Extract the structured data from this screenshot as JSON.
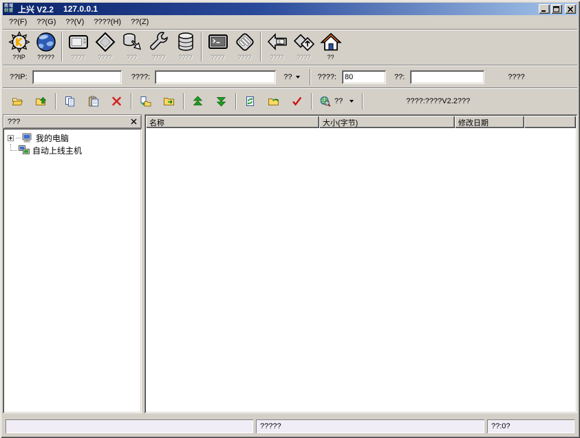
{
  "colors": {
    "window_bg": "#D4D0C8",
    "titlebar_gradient_start": "#0B246B",
    "titlebar_gradient_end": "#A7C7EC",
    "status_panel_fill": "#F0EDF6",
    "disabled_label": "#8A8A8A"
  },
  "titlebar": {
    "logo_text_top": "南域",
    "logo_text_bottom": "剑盟",
    "title": "上兴 V2.2",
    "subtitle": "127.0.0.1"
  },
  "menu": {
    "items": [
      {
        "label": "??(F)"
      },
      {
        "label": "??(G)"
      },
      {
        "label": "??(V)"
      },
      {
        "label": "????(H)"
      },
      {
        "label": "??(Z)"
      }
    ]
  },
  "main_toolbar": {
    "buttons": [
      {
        "label": "??IP",
        "icon": "gear-icon",
        "enabled": true
      },
      {
        "label": "?????",
        "icon": "globe-icon",
        "enabled": true
      },
      {
        "label": "????",
        "icon": "monitor-icon",
        "enabled": false
      },
      {
        "label": "????",
        "icon": "disk-diamond-icon",
        "enabled": false
      },
      {
        "label": "???",
        "icon": "cylinder-arrow-icon",
        "enabled": false
      },
      {
        "label": "????",
        "icon": "wrench-icon",
        "enabled": false
      },
      {
        "label": "????",
        "icon": "database-icon",
        "enabled": false
      },
      {
        "label": "????",
        "icon": "terminal-icon",
        "enabled": false
      },
      {
        "label": "????",
        "icon": "keyboard-diamond-icon",
        "enabled": false
      },
      {
        "label": "????",
        "icon": "image-back-icon",
        "enabled": false
      },
      {
        "label": "????",
        "icon": "diamond-arrow-icon",
        "enabled": false
      },
      {
        "label": "??",
        "icon": "home-icon",
        "enabled": true
      }
    ]
  },
  "address_bar": {
    "ip_label": "??IP:",
    "ip_value": "",
    "domain_label": "????:",
    "domain_value": "",
    "mode_dropdown_label": "??",
    "port_label": "????:",
    "port_value": "80",
    "pass_label": "??:",
    "pass_value": "",
    "action_label": "????"
  },
  "quick_toolbar": {
    "search_dropdown_label": "??",
    "status_text": "????:????V2.2???"
  },
  "tree_panel": {
    "header_title": "???",
    "items": [
      {
        "label": "我的电脑"
      },
      {
        "label": "自动上线主机"
      }
    ]
  },
  "file_list": {
    "columns": [
      {
        "label": "名称"
      },
      {
        "label": "大小(字节)"
      },
      {
        "label": "修改日期"
      },
      {
        "label": ""
      }
    ],
    "rows": []
  },
  "status_bar": {
    "panel_left": "",
    "panel_middle": "?????",
    "panel_right": "??:0?"
  }
}
